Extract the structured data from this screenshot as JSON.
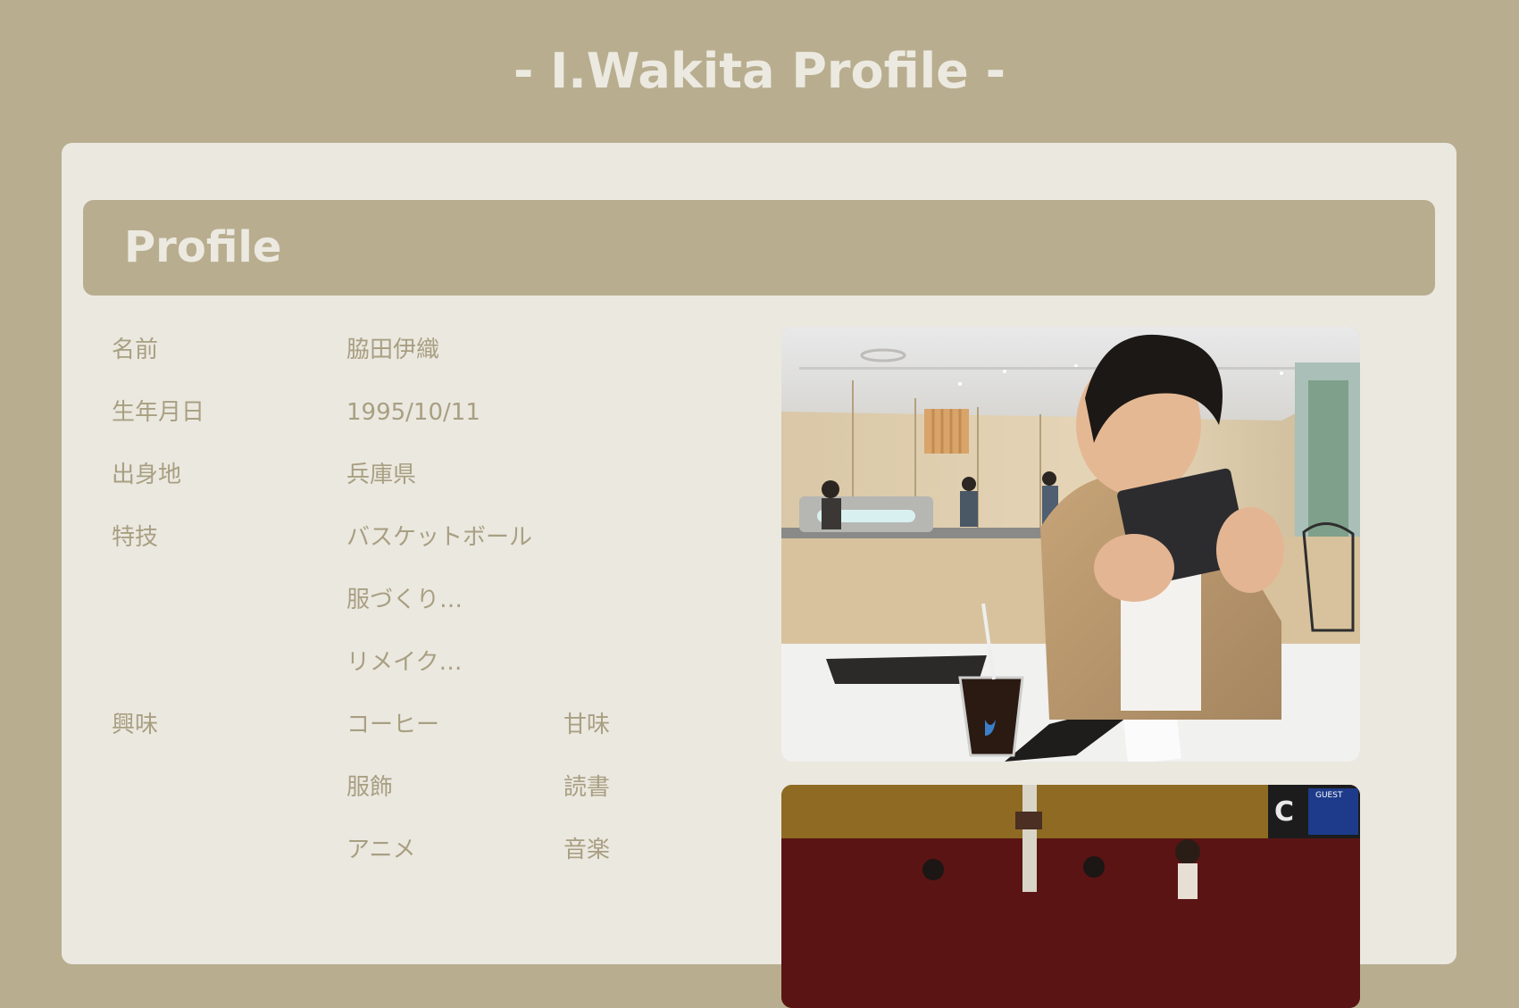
{
  "page": {
    "title": "- I.Wakita Profile -"
  },
  "section": {
    "title": "Profile"
  },
  "profile": {
    "name_label": "名前",
    "name_value": "脇田伊織",
    "birthday_label": "生年月日",
    "birthday_value": "1995/10/11",
    "hometown_label": "出身地",
    "hometown_value": "兵庫県",
    "skills_label": "特技",
    "skills": [
      "バスケットボール",
      "服づくり…",
      "リメイク…"
    ],
    "interests_label": "興味",
    "interests_col1": [
      "コーヒー",
      "服飾",
      "アニメ"
    ],
    "interests_col2": [
      "甘味",
      "読書",
      "音楽"
    ]
  },
  "photos": {
    "cafe": "photo-cafe",
    "gym": "photo-gym"
  },
  "colors": {
    "background": "#b8ae8f",
    "card": "#ebe8e0",
    "title_text": "#ece9e1",
    "body_text": "#a89f82"
  }
}
